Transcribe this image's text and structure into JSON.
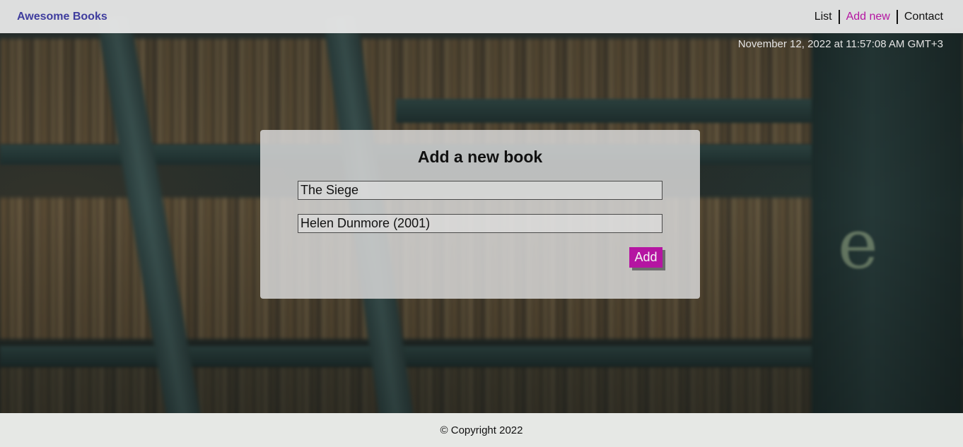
{
  "header": {
    "logo": "Awesome Books",
    "nav": [
      {
        "label": "List",
        "active": false
      },
      {
        "label": "Add new",
        "active": true
      },
      {
        "label": "Contact",
        "active": false
      }
    ]
  },
  "datetime": "November 12, 2022 at 11:57:08 AM GMT+3",
  "form": {
    "heading": "Add a new book",
    "title_value": "The Siege",
    "author_value": "Helen Dunmore (2001)",
    "submit_label": "Add"
  },
  "footer": {
    "copyright": "© Copyright 2022"
  },
  "colors": {
    "accent": "#b515a2",
    "logo": "#3f3d9e"
  }
}
